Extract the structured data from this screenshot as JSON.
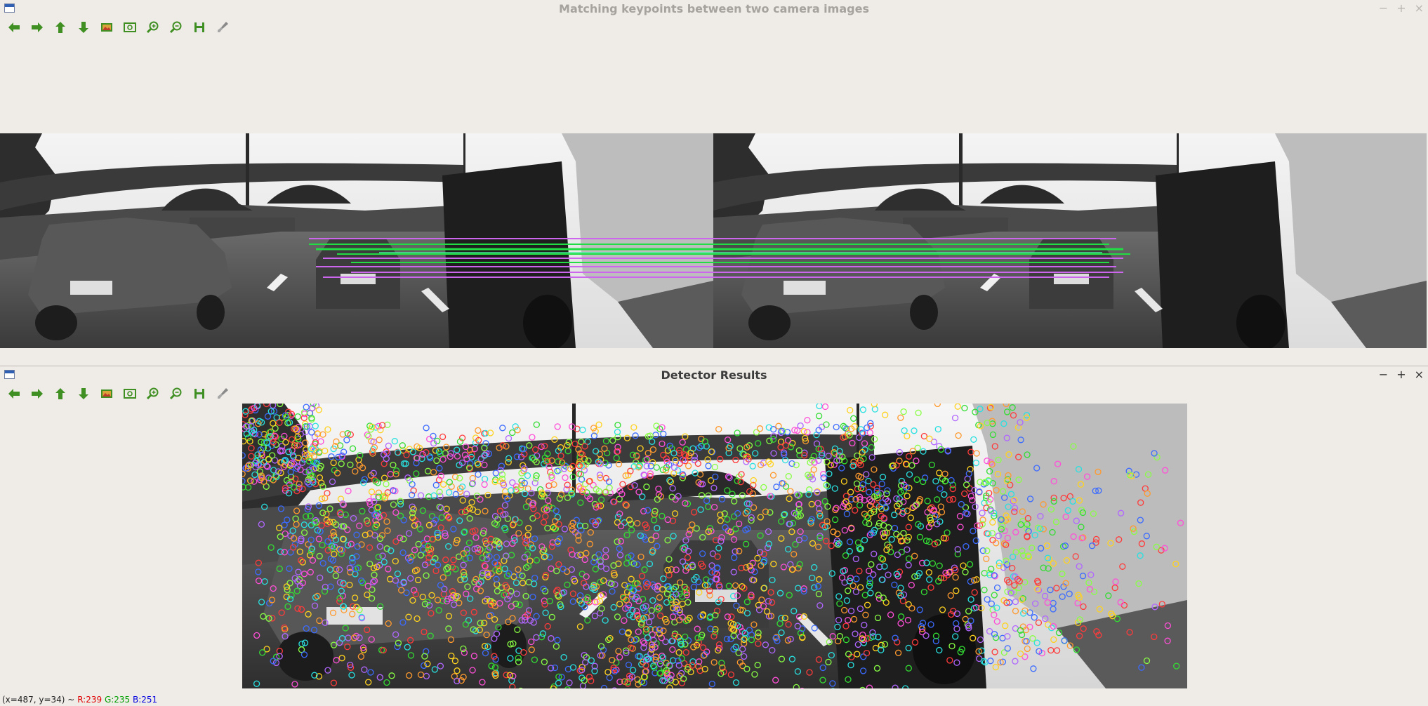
{
  "windows": [
    {
      "title": "Matching keypoints between two camera images",
      "controls": [
        "−",
        "+",
        "×"
      ]
    },
    {
      "title": "Detector Results",
      "controls": [
        "−",
        "+",
        "×"
      ]
    }
  ],
  "toolbar": [
    {
      "name": "pan-left",
      "icon": "arrow-left-icon"
    },
    {
      "name": "pan-right",
      "icon": "arrow-right-icon"
    },
    {
      "name": "pan-up",
      "icon": "arrow-up-icon"
    },
    {
      "name": "pan-down",
      "icon": "arrow-down-icon"
    },
    {
      "name": "zoom-original",
      "icon": "image-icon"
    },
    {
      "name": "zoom-fit",
      "icon": "zoom-fit-icon"
    },
    {
      "name": "zoom-in",
      "icon": "zoom-in-icon"
    },
    {
      "name": "zoom-out",
      "icon": "zoom-out-icon"
    },
    {
      "name": "save-image",
      "icon": "save-icon"
    },
    {
      "name": "properties",
      "icon": "brush-icon"
    }
  ],
  "status": {
    "coords": "(x=487, y=34) ~",
    "r": "R:239",
    "g": "G:235",
    "b": "B:251"
  },
  "colors": {
    "toolbar_icon": "#3f8f22",
    "match_green": "#22dd44",
    "match_purple": "#cc66ee"
  }
}
